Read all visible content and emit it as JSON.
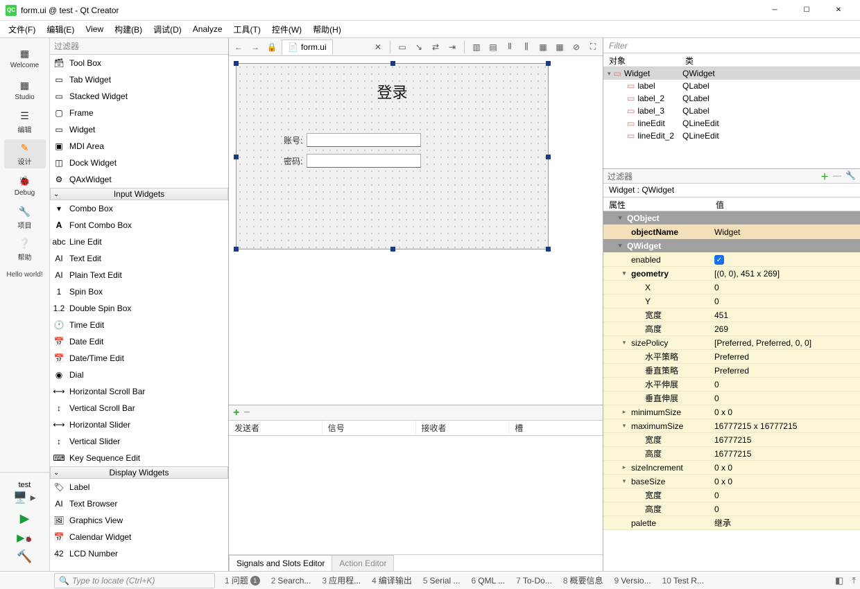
{
  "window": {
    "title": "form.ui @ test - Qt Creator",
    "logo_text": "QC"
  },
  "menu": [
    "文件(F)",
    "编辑(E)",
    "View",
    "构建(B)",
    "调试(D)",
    "Analyze",
    "工具(T)",
    "控件(W)",
    "帮助(H)"
  ],
  "left_rail": {
    "items": [
      {
        "label": "Welcome",
        "icon": "grid"
      },
      {
        "label": "Studio",
        "icon": "grid"
      },
      {
        "label": "编辑",
        "icon": "doc"
      },
      {
        "label": "设计",
        "icon": "pencil",
        "active": true
      },
      {
        "label": "Debug",
        "icon": "bug"
      },
      {
        "label": "项目",
        "icon": "wrench"
      },
      {
        "label": "帮助",
        "icon": "help"
      }
    ],
    "hello": "Hello world!",
    "config": "test"
  },
  "doc_tab": {
    "label": "form.ui"
  },
  "widgetbox": {
    "filter_placeholder": "过滤器",
    "top_cutoff": "Tool Box",
    "container_items": [
      "Tab Widget",
      "Stacked Widget",
      "Frame",
      "Widget",
      "MDI Area",
      "Dock Widget",
      "QAxWidget"
    ],
    "group_input": "Input Widgets",
    "input_items": [
      "Combo Box",
      "Font Combo Box",
      "Line Edit",
      "Text Edit",
      "Plain Text Edit",
      "Spin Box",
      "Double Spin Box",
      "Time Edit",
      "Date Edit",
      "Date/Time Edit",
      "Dial",
      "Horizontal Scroll Bar",
      "Vertical Scroll Bar",
      "Horizontal Slider",
      "Vertical Slider",
      "Key Sequence Edit"
    ],
    "group_display": "Display Widgets",
    "display_items": [
      "Label",
      "Text Browser",
      "Graphics View",
      "Calendar Widget",
      "LCD Number"
    ]
  },
  "form": {
    "title": "登录",
    "account_label": "账号:",
    "password_label": "密码:"
  },
  "signals": {
    "add": "+",
    "remove": "−",
    "cols": [
      "发送者",
      "信号",
      "接收者",
      "槽"
    ],
    "tab_active": "Signals and Slots Editor",
    "tab_inactive": "Action Editor"
  },
  "object_inspector": {
    "filter_placeholder": "Filter",
    "col_obj": "对象",
    "col_class": "类",
    "rows": [
      {
        "name": "Widget",
        "cls": "QWidget",
        "indent": 0,
        "sel": true,
        "exp": "v"
      },
      {
        "name": "label",
        "cls": "QLabel",
        "indent": 1
      },
      {
        "name": "label_2",
        "cls": "QLabel",
        "indent": 1
      },
      {
        "name": "label_3",
        "cls": "QLabel",
        "indent": 1
      },
      {
        "name": "lineEdit",
        "cls": "QLineEdit",
        "indent": 1
      },
      {
        "name": "lineEdit_2",
        "cls": "QLineEdit",
        "indent": 1
      }
    ]
  },
  "property_editor": {
    "filter_placeholder": "过滤器",
    "title": "Widget : QWidget",
    "col_prop": "属性",
    "col_val": "值",
    "rows": [
      {
        "type": "grp",
        "k": "QObject",
        "exp": "v"
      },
      {
        "type": "obj",
        "k": "objectName",
        "v": "Widget"
      },
      {
        "type": "grp",
        "k": "QWidget",
        "exp": "v"
      },
      {
        "type": "w",
        "k": "enabled",
        "v": "check",
        "indent": 1
      },
      {
        "type": "w",
        "k": "geometry",
        "v": "[(0, 0), 451 x 269]",
        "bold": true,
        "exp": "v",
        "indent": 1
      },
      {
        "type": "w",
        "k": "X",
        "v": "0",
        "sub": true
      },
      {
        "type": "w",
        "k": "Y",
        "v": "0",
        "sub": true
      },
      {
        "type": "w",
        "k": "宽度",
        "v": "451",
        "sub": true
      },
      {
        "type": "w",
        "k": "高度",
        "v": "269",
        "sub": true
      },
      {
        "type": "w",
        "k": "sizePolicy",
        "v": "[Preferred, Preferred, 0, 0]",
        "exp": "v",
        "indent": 1
      },
      {
        "type": "w",
        "k": "水平策略",
        "v": "Preferred",
        "sub": true
      },
      {
        "type": "w",
        "k": "垂直策略",
        "v": "Preferred",
        "sub": true
      },
      {
        "type": "w",
        "k": "水平伸展",
        "v": "0",
        "sub": true
      },
      {
        "type": "w",
        "k": "垂直伸展",
        "v": "0",
        "sub": true
      },
      {
        "type": "w",
        "k": "minimumSize",
        "v": "0 x 0",
        "exp": ">",
        "indent": 1
      },
      {
        "type": "w",
        "k": "maximumSize",
        "v": "16777215 x 16777215",
        "exp": "v",
        "indent": 1
      },
      {
        "type": "w",
        "k": "宽度",
        "v": "16777215",
        "sub": true
      },
      {
        "type": "w",
        "k": "高度",
        "v": "16777215",
        "sub": true
      },
      {
        "type": "w",
        "k": "sizeIncrement",
        "v": "0 x 0",
        "exp": ">",
        "indent": 1
      },
      {
        "type": "w",
        "k": "baseSize",
        "v": "0 x 0",
        "exp": "v",
        "indent": 1
      },
      {
        "type": "w",
        "k": "宽度",
        "v": "0",
        "sub": true
      },
      {
        "type": "w",
        "k": "高度",
        "v": "0",
        "sub": true
      },
      {
        "type": "w",
        "k": "palette",
        "v": "继承",
        "indent": 1
      }
    ]
  },
  "status": {
    "search_placeholder": "Type to locate (Ctrl+K)",
    "items": [
      {
        "n": "1",
        "label": "问题",
        "badge": "1"
      },
      {
        "n": "2",
        "label": "Search..."
      },
      {
        "n": "3",
        "label": "应用程..."
      },
      {
        "n": "4",
        "label": "编译输出"
      },
      {
        "n": "5",
        "label": "Serial ..."
      },
      {
        "n": "6",
        "label": "QML ..."
      },
      {
        "n": "7",
        "label": "To-Do..."
      },
      {
        "n": "8",
        "label": "概要信息"
      },
      {
        "n": "9",
        "label": "Versio..."
      },
      {
        "n": "10",
        "label": "Test R..."
      }
    ]
  }
}
